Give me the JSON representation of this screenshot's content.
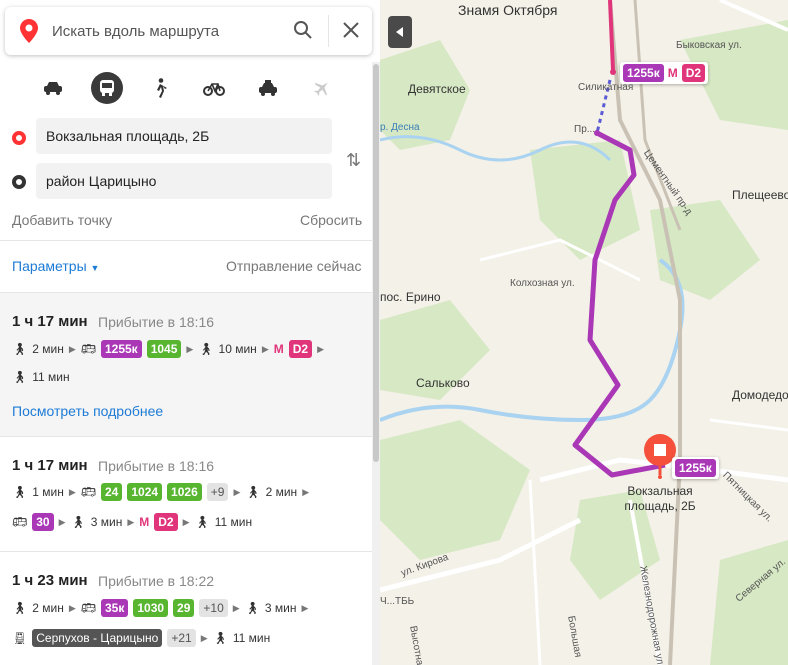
{
  "search": {
    "placeholder": "Искать вдоль маршрута"
  },
  "modes": [
    "car-icon",
    "bus-icon",
    "walk-icon",
    "bike-icon",
    "taxi-icon",
    "plane-icon"
  ],
  "from": "Вокзальная площадь, 2Б",
  "to": "район Царицыно",
  "add_point": "Добавить точку",
  "reset": "Сбросить",
  "params": "Параметры",
  "departure": "Отправление сейчас",
  "routes": [
    {
      "time": "1 ч 17 мин",
      "arrival": "Прибытие в 18:16",
      "walk1": "2 мин",
      "bus1": "1255к",
      "bus2": "1045",
      "walk2": "10 мин",
      "metro": "D2",
      "walk3": "11 мин",
      "details": "Посмотреть подробнее"
    },
    {
      "time": "1 ч 17 мин",
      "arrival": "Прибытие в 18:16",
      "walk1": "1 мин",
      "bus1": "24",
      "bus2": "1024",
      "bus3": "1026",
      "more": "+9",
      "walk2": "2 мин",
      "bus4": "30",
      "walk3": "3 мин",
      "metro": "D2",
      "walk4": "11 мин"
    },
    {
      "time": "1 ч 23 мин",
      "arrival": "Прибытие в 18:22",
      "walk1": "2 мин",
      "bus1": "35к",
      "bus2": "1030",
      "bus3": "29",
      "more": "+10",
      "walk2": "3 мин",
      "train": "Серпухов - Царицыно",
      "more2": "+21",
      "walk3": "11 мин"
    }
  ],
  "map": {
    "labels": {
      "znamya": "Знамя Октября",
      "devyatskoe": "Девятское",
      "desna": "р. Десна",
      "silikatnaya": "Силикатная",
      "bykovskaya": "Быковская ул.",
      "cementny": "Цементный пр-д",
      "pleshcheevo": "Плещеево",
      "kolkhoznaya": "Колхозная ул.",
      "erino": "пос. Ерино",
      "salkovo": "Сальково",
      "domodedovo": "Домодедово",
      "vokzal": "Вокзальная площадь, 2Б",
      "kirova": "ул. Кирова",
      "vysotnaya": "Высотная",
      "bolshaya": "Большая",
      "zheleznodorozhnaya": "Железнодорожная ул.",
      "severnaya": "Северная ул.",
      "pyatnitskaya": "Пятницкая ул.",
      "chtb": "Ч...ТБЬ",
      "pr": "Пр..."
    },
    "chip_top_bus": "1255к",
    "chip_top_metro": "D2",
    "chip_bottom_bus": "1255к"
  }
}
